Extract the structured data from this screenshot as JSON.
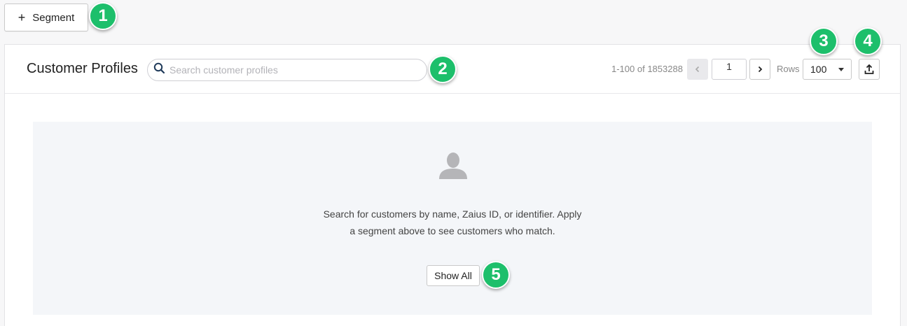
{
  "toolbar": {
    "plus_glyph": "+",
    "segment_label": "Segment"
  },
  "callouts": [
    "1",
    "2",
    "3",
    "4",
    "5"
  ],
  "header": {
    "title": "Customer Profiles",
    "search_placeholder": "Search customer profiles"
  },
  "pagination": {
    "range_text": "1-100 of 1853288",
    "prev_glyph": "‹",
    "next_glyph": "›",
    "current_page": "1",
    "rows_label": "Rows",
    "rows_value": "100"
  },
  "empty_state": {
    "line1": "Search for customers by name, Zaius ID, or identifier. Apply",
    "line2": "a segment above to see customers who match.",
    "show_all_label": "Show All"
  },
  "icons": {
    "search": "search-icon",
    "person": "person-icon",
    "export": "export-icon",
    "dropdown": "chevron-down-icon"
  },
  "colors": {
    "callout": "#1dbf6b",
    "search_icon": "#1f3a5a",
    "person_icon": "#b5b5b8"
  }
}
